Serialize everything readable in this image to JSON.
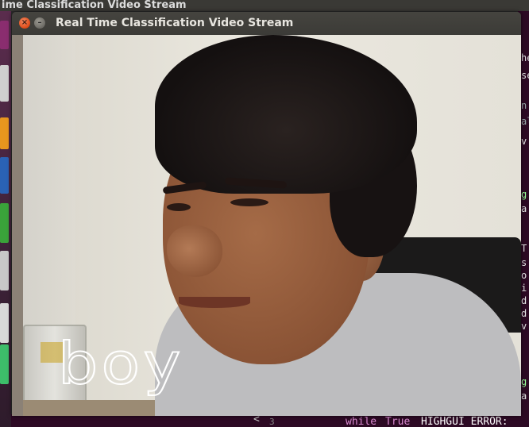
{
  "background_title": "ime Classification Video Stream",
  "window": {
    "title": "Real Time Classification Video Stream",
    "close_glyph": "×",
    "minimize_glyph": "–"
  },
  "prediction": {
    "label": "boy"
  },
  "editor_fragments": [
    "he",
    "se",
    "n",
    "al",
    "v",
    "g",
    "a",
    "T",
    "s",
    "o",
    "i",
    "d",
    "d",
    "v",
    "g",
    "a"
  ],
  "terminal": {
    "arrow": "<",
    "line_number": "3",
    "code_keyword": "while",
    "code_value": "True",
    "error_text": "HIGHGUI ERROR:"
  },
  "colors": {
    "close_button": "#df4a16",
    "titlebar": "#3c3b37",
    "launcher": "#5a2c4d",
    "editor_bg": "#2d0a24",
    "label_color": "#ffffff"
  },
  "icons": [
    "close-icon",
    "minimize-icon"
  ]
}
